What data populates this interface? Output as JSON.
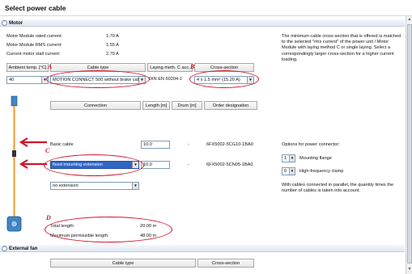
{
  "window": {
    "title": "Select power cable"
  },
  "sections": {
    "motor": "Motor",
    "external_fan": "External fan"
  },
  "motor_info": {
    "rows": [
      {
        "label": "Motor Module rated current:",
        "value": "1.70 A"
      },
      {
        "label": "Motor Module RMS current:",
        "value": "1.55 A"
      },
      {
        "label": "Current motor stall current:",
        "value": "2.70 A"
      }
    ],
    "note": "The minimum cable cross-section that is offered is matched to the selected \"rms current\" of the power unit / Motor Module with laying method C or single laying. Select a correspondingly larger cross-section for a higher current loading."
  },
  "cable_table": {
    "headers": {
      "ambient": "Ambient temp. [°C]",
      "type": "Cable type",
      "laying": "Laying meth. C acc. to",
      "cross": "Cross-section"
    },
    "values": {
      "ambient": "40",
      "type": "MOTION CONNECT 500 without brake cable",
      "laying": "DIN EN 60204-1",
      "cross": "4 x 1.5 mm² (15.20 A)"
    }
  },
  "connection_table": {
    "headers": {
      "connection": "Connection",
      "length": "Length [m]",
      "drum": "Drum [m]",
      "order": "Order designation"
    },
    "rows": [
      {
        "label": "Basic cable",
        "length": "10.0",
        "drum": "-",
        "order": "6FX5002-5CG10-1BA0"
      },
      {
        "select": "fixed mounting extension",
        "length": "10.0",
        "drum": "-",
        "order": "6FX5002-5CN05-1BA0"
      },
      {
        "select": "no extension"
      }
    ]
  },
  "connector_options": {
    "title": "Options for power connector:",
    "mounting": {
      "value": "1",
      "label": "Mounting flange"
    },
    "hf_clamp": {
      "value": "0",
      "label": "High-frequency clamp"
    },
    "parallel_note": "With cables connected in parallel, the quantity times the number of cables is taken into account."
  },
  "totals": {
    "total_label": "Total length:",
    "total_value": "20.00 m",
    "max_label": "Maximum permissible length:",
    "max_value": "48.00 m"
  },
  "fan_table": {
    "type": "Cable type",
    "cross": "Cross-section"
  },
  "annotations": {
    "a": "A",
    "b": "B",
    "c": "C",
    "d": "D"
  },
  "colors": {
    "annotation_red": "#d2132a",
    "cable_orange": "#f39a2c",
    "connector_blue": "#3e86c6"
  }
}
